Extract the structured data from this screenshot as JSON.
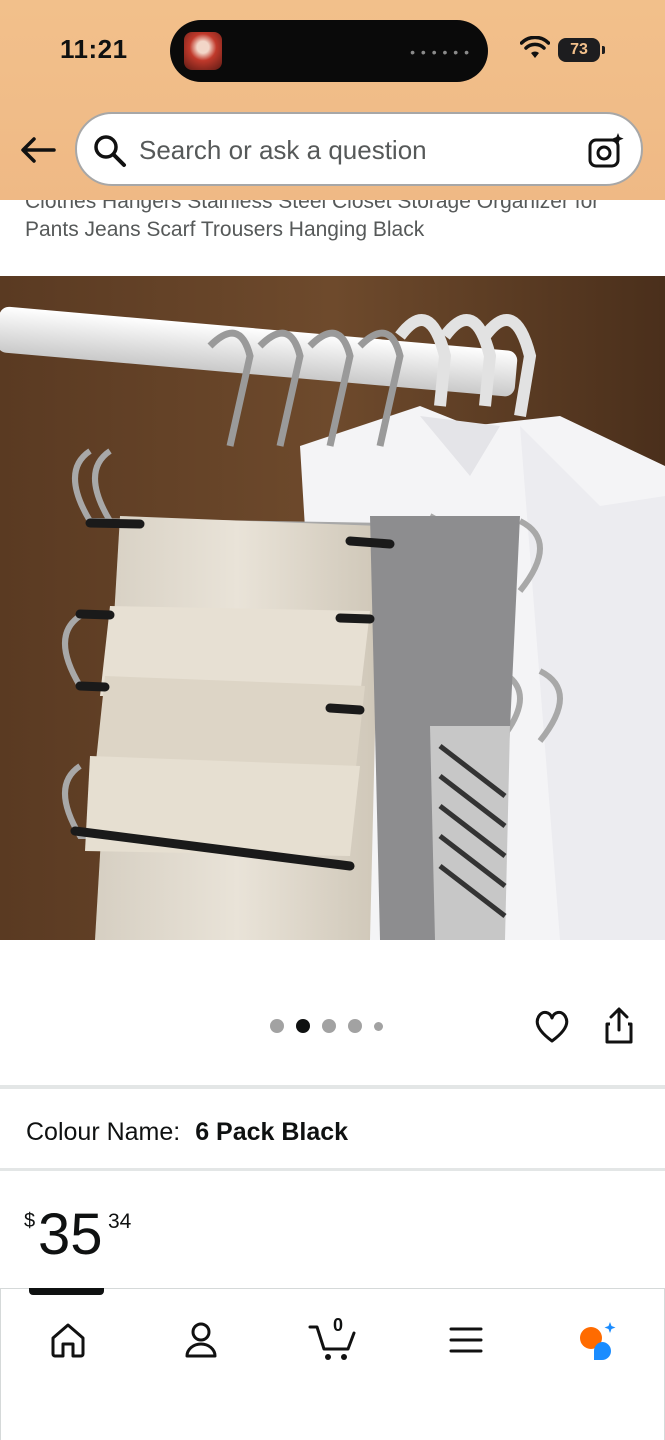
{
  "status_bar": {
    "time": "11:21",
    "battery": "73"
  },
  "search": {
    "placeholder": "Search or ask a question"
  },
  "product": {
    "title": "Clothes Hangers Stainless Steel Closet Storage Organizer for Pants Jeans Scarf Trousers Hanging Black",
    "image": {
      "description": "stainless steel S-shaped pant hangers",
      "slides": 5,
      "active_slide": 2
    },
    "colour_label": "Colour Name:",
    "colour_value": "6 Pack Black",
    "price": {
      "currency": "$",
      "whole": "35",
      "fraction": "34"
    }
  },
  "nav": {
    "items": [
      "home-icon",
      "account-icon",
      "cart-icon",
      "menu-icon",
      "rufus-icon"
    ],
    "cart_count": "0",
    "active": "home"
  },
  "colors": {
    "header_bg": "#f2c08b",
    "text": "#0f1111",
    "secondary_text": "#565959",
    "accent": "#ff6b00"
  }
}
